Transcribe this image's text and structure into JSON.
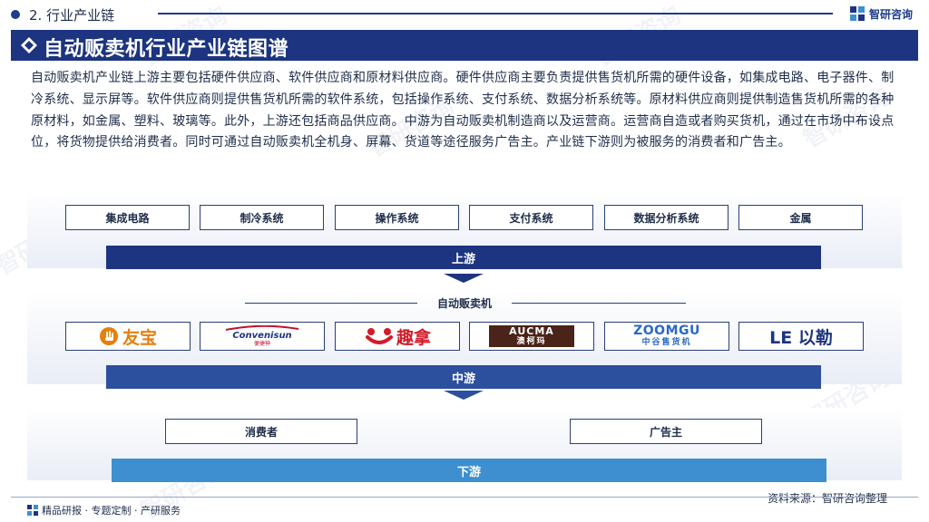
{
  "header": {
    "section_label": "2. 行业产业链",
    "brand_name": "智研咨询"
  },
  "title": "自动贩卖机行业产业链图谱",
  "description": "自动贩卖机产业链上游主要包括硬件供应商、软件供应商和原材料供应商。硬件供应商主要负责提供售货机所需的硬件设备，如集成电路、电子器件、制冷系统、显示屏等。软件供应商则提供售货机所需的软件系统，包括操作系统、支付系统、数据分析系统等。原材料供应商则提供制造售货机所需的各种原材料，如金属、塑料、玻璃等。此外，上游还包括商品供应商。中游为自动贩卖机制造商以及运营商。运营商自造或者购买货机，通过在市场中布设点位，将货物提供给消费者。同时可通过自动贩卖机全机身、屏幕、货道等途径服务广告主。产业链下游则为被服务的消费者和广告主。",
  "upstream": {
    "label": "上游",
    "items": [
      "集成电路",
      "制冷系统",
      "操作系统",
      "支付系统",
      "数据分析系统",
      "金属"
    ]
  },
  "midstream": {
    "label": "中游",
    "header": "自动贩卖机",
    "logos": [
      {
        "name": "youbao",
        "text": "友宝",
        "icon": "hand-icon",
        "color": "#e5800f"
      },
      {
        "name": "convenisun",
        "text": "Convenisun",
        "sub": "便捷神",
        "icon": "swoosh-icon",
        "color": "#c0142a"
      },
      {
        "name": "quna",
        "text": "趣拿",
        "icon": "smile-icon",
        "color": "#d31b2a"
      },
      {
        "name": "aucma",
        "text": "AUCMA",
        "sub": "澳柯玛",
        "icon": "",
        "color": "#4a2418"
      },
      {
        "name": "zoomgu",
        "text": "ZOOMGU",
        "sub": "中谷售货机",
        "icon": "",
        "color": "#2a68c8"
      },
      {
        "name": "leqi",
        "text": "LE 以勒",
        "icon": "",
        "color": "#1d3480"
      }
    ]
  },
  "downstream": {
    "label": "下游",
    "items": [
      "消费者",
      "广告主"
    ]
  },
  "footer": {
    "tagline": "精品研报 · 专题定制 · 产研服务",
    "source": "资料来源：智研咨询整理"
  },
  "colors": {
    "primary": "#1d3480",
    "mid": "#2c4f9e",
    "light": "#3d8fd0"
  }
}
